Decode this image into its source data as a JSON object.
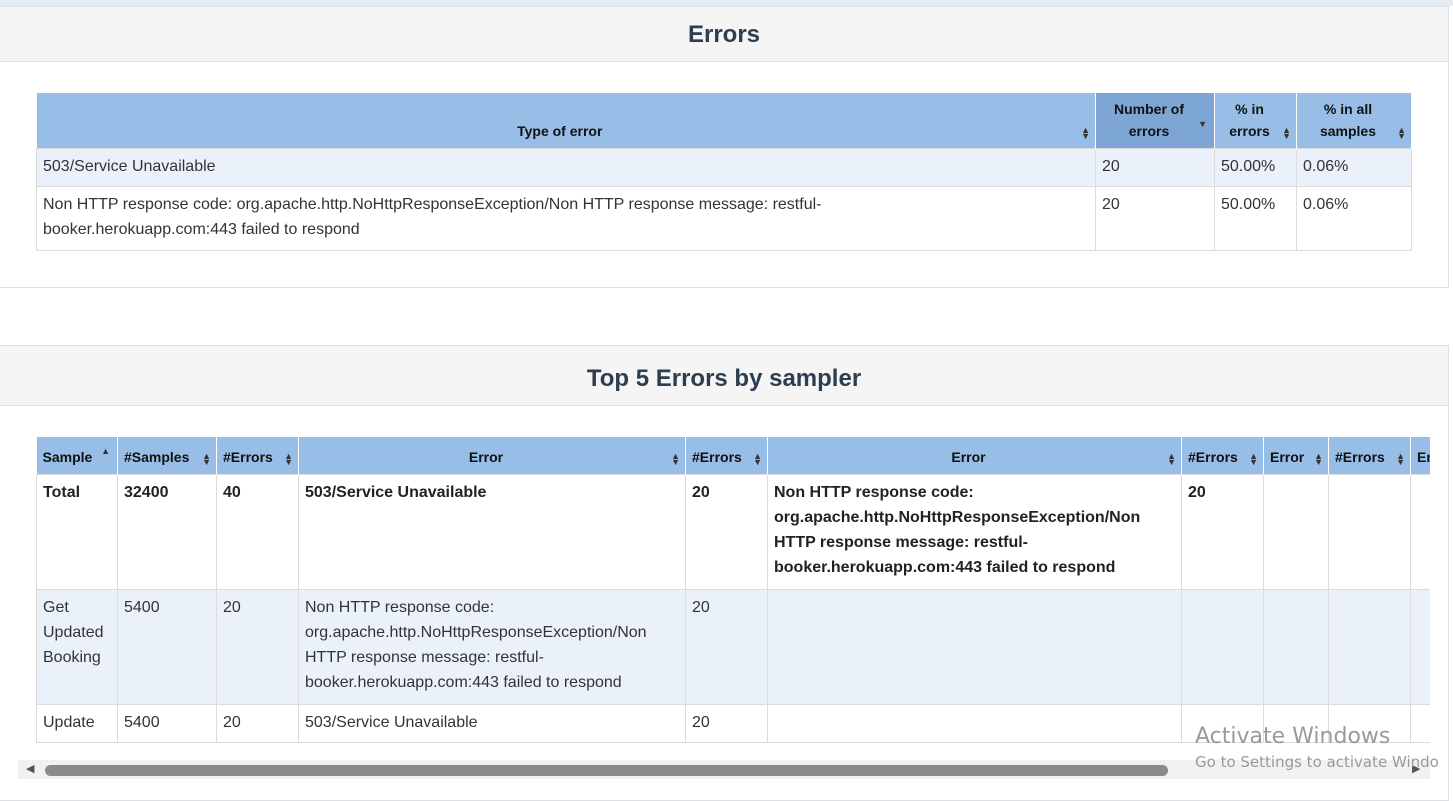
{
  "errors_panel": {
    "title": "Errors",
    "columns": [
      "Type of error",
      "Number of errors",
      "% in errors",
      "% in all samples"
    ],
    "rows": [
      {
        "type": "503/Service Unavailable",
        "count": "20",
        "pct_errors": "50.00%",
        "pct_samples": "0.06%"
      },
      {
        "type": "Non HTTP response code: org.apache.http.NoHttpResponseException/Non HTTP response message: restful-booker.herokuapp.com:443 failed to respond",
        "count": "20",
        "pct_errors": "50.00%",
        "pct_samples": "0.06%"
      }
    ]
  },
  "top5_panel": {
    "title": "Top 5 Errors by sampler",
    "columns": [
      "Sample",
      "#Samples",
      "#Errors",
      "Error",
      "#Errors",
      "Error",
      "#Errors",
      "Error",
      "#Errors",
      "Er"
    ],
    "rows": [
      {
        "sample": "Total",
        "samples": "32400",
        "errors": "40",
        "error1": "503/Service Unavailable",
        "errors1": "20",
        "error2": "Non HTTP response code: org.apache.http.NoHttpResponseException/Non HTTP response message: restful-booker.herokuapp.com:443 failed to respond",
        "errors2": "20",
        "error3": "",
        "errors3": "",
        "error4": ""
      },
      {
        "sample": "Get Updated Booking",
        "samples": "5400",
        "errors": "20",
        "error1": "Non HTTP response code: org.apache.http.NoHttpResponseException/Non HTTP response message: restful-booker.herokuapp.com:443 failed to respond",
        "errors1": "20",
        "error2": "",
        "errors2": "",
        "error3": "",
        "errors3": "",
        "error4": ""
      },
      {
        "sample": "Update",
        "samples": "5400",
        "errors": "20",
        "error1": "503/Service Unavailable",
        "errors1": "20",
        "error2": "",
        "errors2": "",
        "error3": "",
        "errors3": "",
        "error4": ""
      }
    ]
  },
  "watermark": {
    "title": "Activate Windows",
    "subtitle": "Go to Settings to activate Windo"
  },
  "colors": {
    "header_bg": "#98bde6",
    "header_sorted_bg": "#7ea6d4",
    "row_alt_bg": "#eaf1fa",
    "title_color": "#2c3e50"
  }
}
